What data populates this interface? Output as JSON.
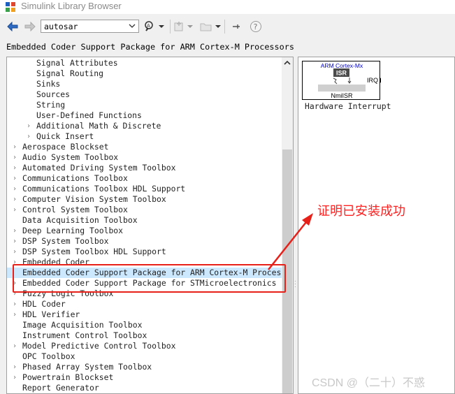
{
  "window": {
    "title": "Simulink Library Browser"
  },
  "toolbar": {
    "search_value": "autosar",
    "back_icon": "arrow-left-icon",
    "forward_icon": "arrow-right-icon"
  },
  "breadcrumb": "Embedded Coder Support Package for ARM Cortex-M Processors",
  "tree": {
    "items": [
      {
        "label": "Signal Attributes",
        "level": 2,
        "expandable": false,
        "selected": false
      },
      {
        "label": "Signal Routing",
        "level": 2,
        "expandable": false,
        "selected": false
      },
      {
        "label": "Sinks",
        "level": 2,
        "expandable": false,
        "selected": false
      },
      {
        "label": "Sources",
        "level": 2,
        "expandable": false,
        "selected": false
      },
      {
        "label": "String",
        "level": 2,
        "expandable": false,
        "selected": false
      },
      {
        "label": "User-Defined Functions",
        "level": 2,
        "expandable": false,
        "selected": false
      },
      {
        "label": "Additional Math & Discrete",
        "level": 2,
        "expandable": true,
        "selected": false
      },
      {
        "label": "Quick Insert",
        "level": 2,
        "expandable": true,
        "selected": false
      },
      {
        "label": "Aerospace Blockset",
        "level": 1,
        "expandable": true,
        "selected": false
      },
      {
        "label": "Audio System Toolbox",
        "level": 1,
        "expandable": true,
        "selected": false
      },
      {
        "label": "Automated Driving System Toolbox",
        "level": 1,
        "expandable": true,
        "selected": false
      },
      {
        "label": "Communications Toolbox",
        "level": 1,
        "expandable": true,
        "selected": false
      },
      {
        "label": "Communications Toolbox HDL Support",
        "level": 1,
        "expandable": true,
        "selected": false
      },
      {
        "label": "Computer Vision System Toolbox",
        "level": 1,
        "expandable": true,
        "selected": false
      },
      {
        "label": "Control System Toolbox",
        "level": 1,
        "expandable": true,
        "selected": false
      },
      {
        "label": "Data Acquisition Toolbox",
        "level": 1,
        "expandable": false,
        "selected": false
      },
      {
        "label": "Deep Learning Toolbox",
        "level": 1,
        "expandable": true,
        "selected": false
      },
      {
        "label": "DSP System Toolbox",
        "level": 1,
        "expandable": true,
        "selected": false
      },
      {
        "label": "DSP System Toolbox HDL Support",
        "level": 1,
        "expandable": true,
        "selected": false
      },
      {
        "label": "Embedded Coder",
        "level": 1,
        "expandable": true,
        "selected": false
      },
      {
        "label": "Embedded Coder Support Package for ARM Cortex-M Processors",
        "level": 1,
        "expandable": false,
        "selected": true
      },
      {
        "label": "Embedded Coder Support Package for STMicroelectronics Discover",
        "level": 1,
        "expandable": true,
        "selected": false
      },
      {
        "label": "Fuzzy Logic Toolbox",
        "level": 1,
        "expandable": true,
        "selected": false
      },
      {
        "label": "HDL Coder",
        "level": 1,
        "expandable": true,
        "selected": false
      },
      {
        "label": "HDL Verifier",
        "level": 1,
        "expandable": true,
        "selected": false
      },
      {
        "label": "Image Acquisition Toolbox",
        "level": 1,
        "expandable": false,
        "selected": false
      },
      {
        "label": "Instrument Control Toolbox",
        "level": 1,
        "expandable": false,
        "selected": false
      },
      {
        "label": "Model Predictive Control Toolbox",
        "level": 1,
        "expandable": true,
        "selected": false
      },
      {
        "label": "OPC Toolbox",
        "level": 1,
        "expandable": false,
        "selected": false
      },
      {
        "label": "Phased Array System Toolbox",
        "level": 1,
        "expandable": true,
        "selected": false
      },
      {
        "label": "Powertrain Blockset",
        "level": 1,
        "expandable": true,
        "selected": false
      },
      {
        "label": "Report Generator",
        "level": 1,
        "expandable": false,
        "selected": false
      }
    ]
  },
  "block": {
    "header": "ARM Cortex-Mx",
    "isr_label": "ISR",
    "port_label": "IRQ",
    "irq_name": "NmiISR",
    "caption": "Hardware Interrupt"
  },
  "annotation": {
    "text": "证明已安装成功",
    "color": "#ff2020"
  },
  "watermark": "CSDN @（二十）不惑",
  "colors": {
    "selection": "#cce8ff",
    "highlight_box": "#e8201a",
    "block_header": "#0000cc"
  }
}
